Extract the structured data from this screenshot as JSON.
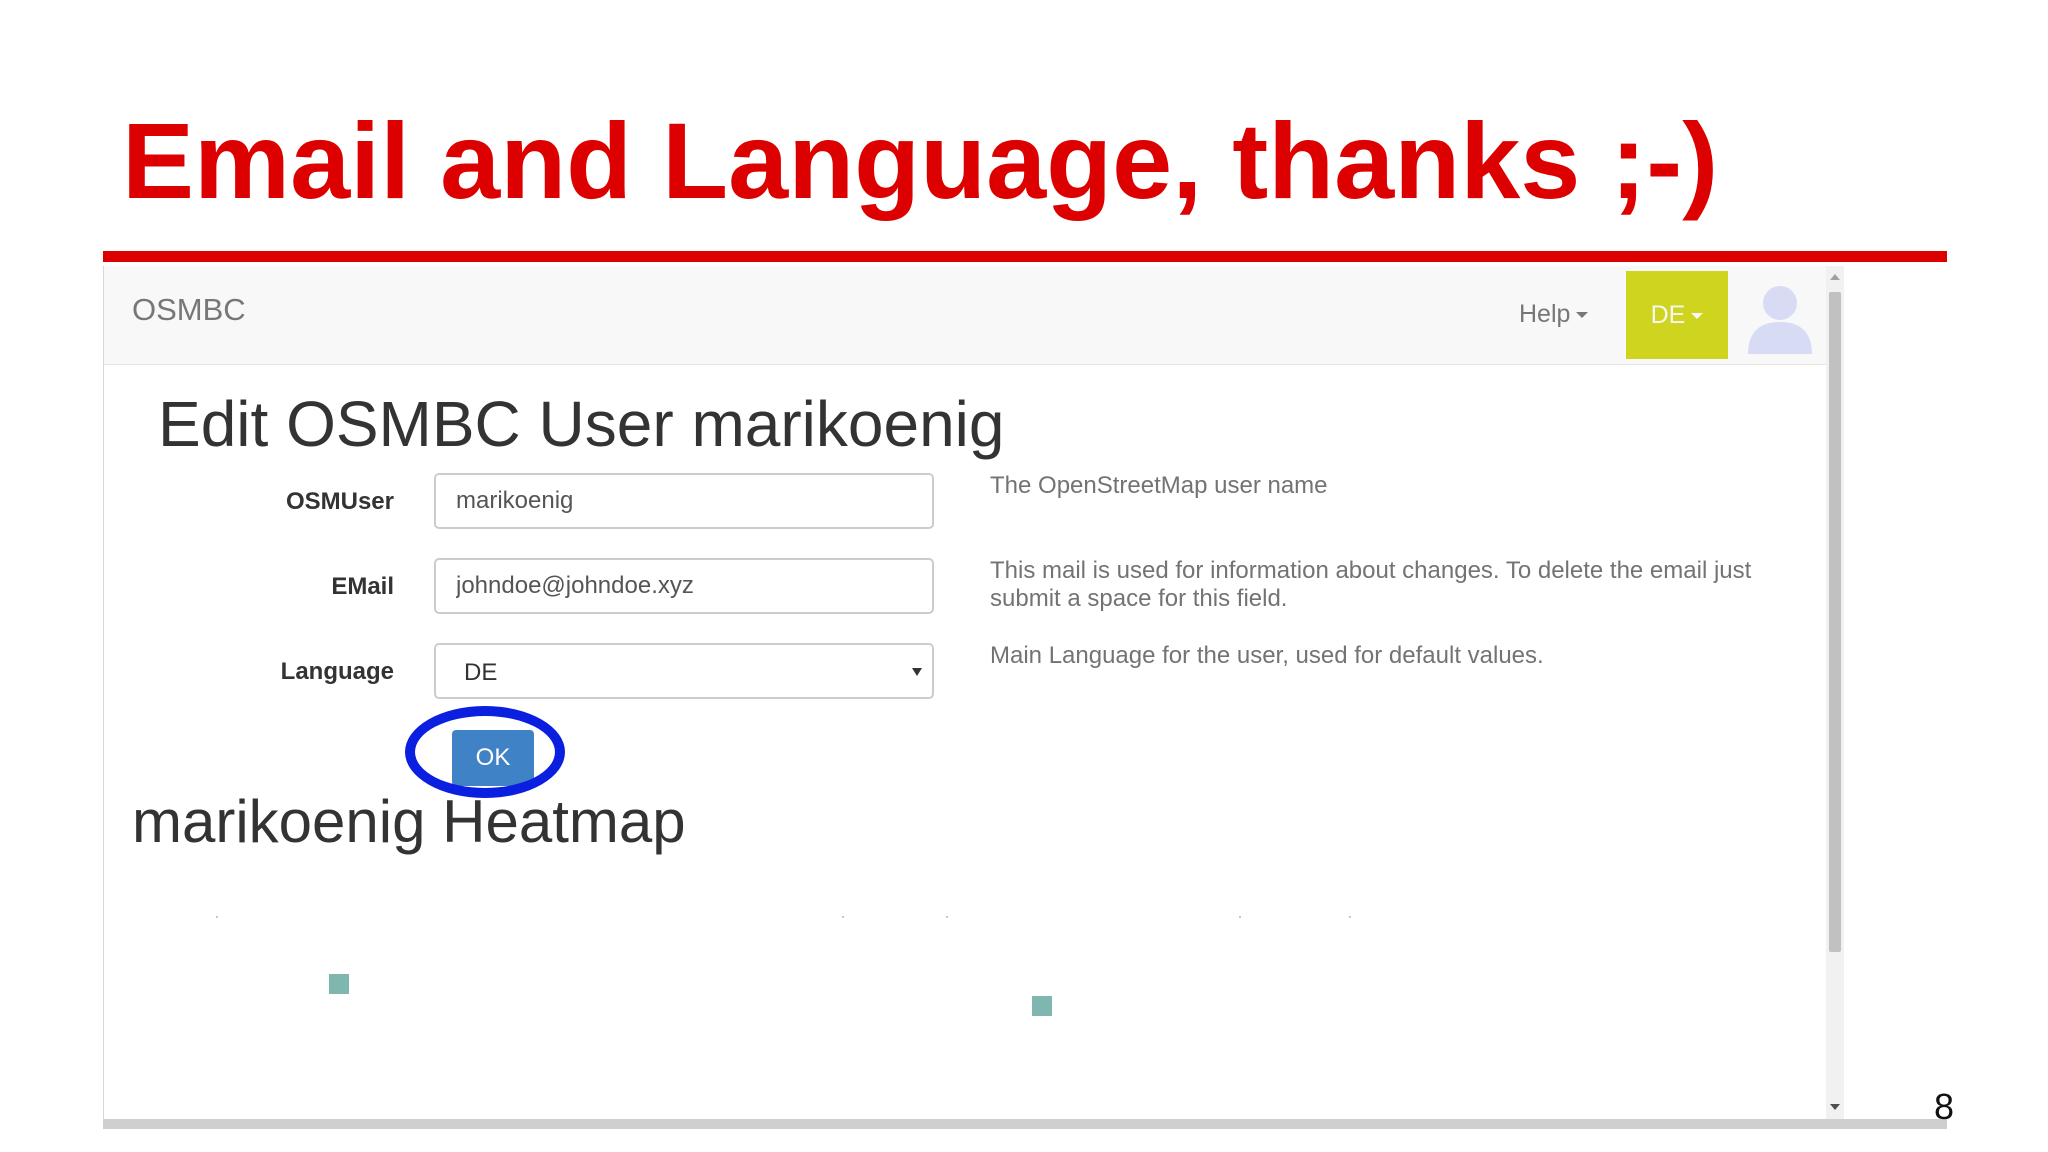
{
  "slide": {
    "title": "Email and Language, thanks ;-)",
    "page_number": "8",
    "accent_color": "#dd0000",
    "highlight_color": "#0b1fe0"
  },
  "navbar": {
    "brand": "OSMBC",
    "help_label": "Help",
    "language_label": "DE",
    "language_button_color": "#cfd41e",
    "avatar_icon": "user-avatar-icon"
  },
  "form": {
    "heading": "Edit OSMBC User marikoenig",
    "fields": {
      "osmuser": {
        "label": "OSMUser",
        "value": "marikoenig",
        "help": "The OpenStreetMap user name"
      },
      "email": {
        "label": "EMail",
        "value": "johndoe@johndoe.xyz",
        "help": "This mail is used for information about changes. To delete the email just submit a space for this field."
      },
      "language": {
        "label": "Language",
        "value": "DE",
        "help": "Main Language for the user, used for default values."
      }
    },
    "ok_label": "OK",
    "ok_button_color": "#3f82c6"
  },
  "heatmap": {
    "heading": "marikoenig Heatmap",
    "cell_color": "#7fb7ae"
  }
}
